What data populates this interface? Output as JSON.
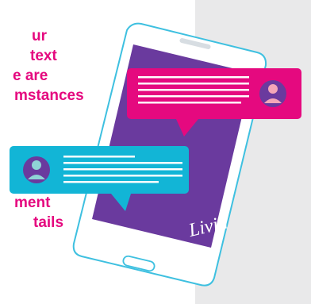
{
  "top_text": {
    "lines": [
      "ur",
      "text",
      "e are",
      "mstances"
    ]
  },
  "bottom_text": {
    "lines": [
      "ment",
      "tails"
    ]
  },
  "logo_text": "Livin",
  "colors": {
    "magenta": "#e5097f",
    "cyan": "#12b5d6",
    "purple": "#6a3a9e",
    "phone_frame": "#ffffff",
    "phone_outline": "#3ec0e0",
    "grey_panel": "#e9e9ea",
    "avatar_pink": "#f4a6b8",
    "avatar_teal": "#8fd4d6",
    "avatar_bg": "#6a3a9e"
  },
  "icons": {
    "top_bubble_avatar": "user-avatar-icon",
    "bottom_bubble_avatar": "user-avatar-icon"
  }
}
